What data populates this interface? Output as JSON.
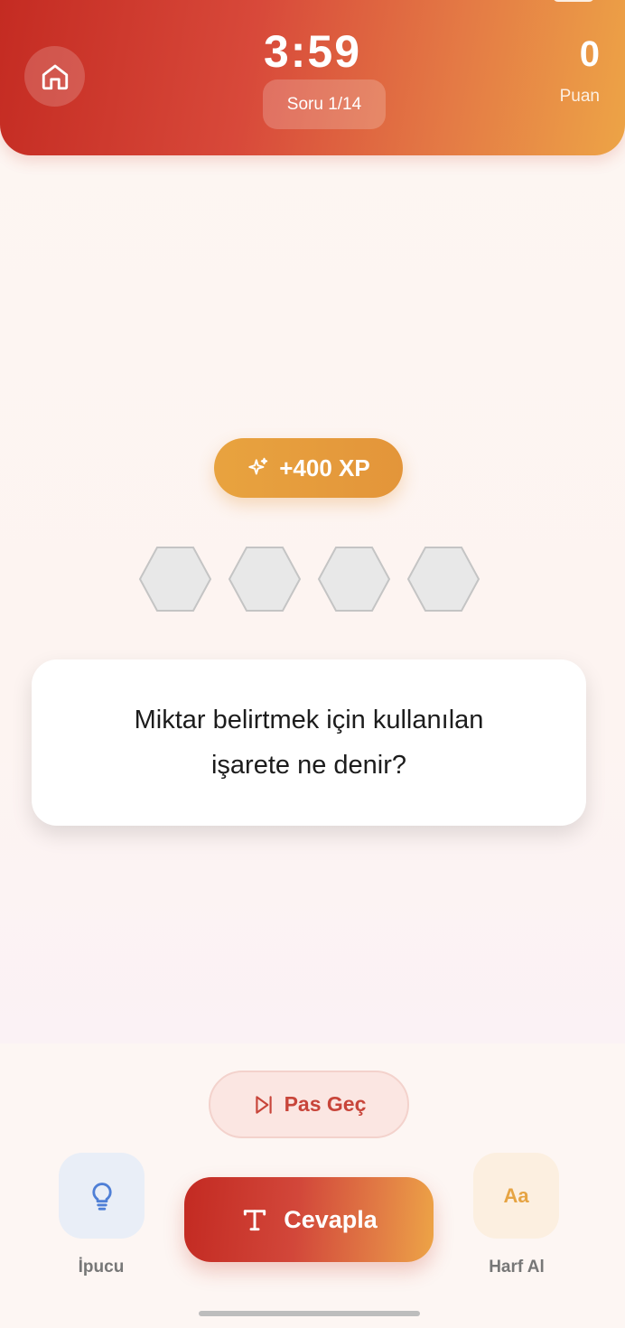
{
  "header": {
    "timer": "3:59",
    "question_counter": "Soru 1/14",
    "score_value": "0",
    "score_label": "Puan",
    "home_icon": "home-icon"
  },
  "reward": {
    "xp_label": "+400 XP",
    "icon": "sparkle-icon"
  },
  "answer_slots": 4,
  "question": {
    "text": "Miktar belirtmek için kullanılan işarete ne denir?"
  },
  "actions": {
    "skip_label": "Pas Geç",
    "skip_icon": "skip-forward-icon",
    "hint_label": "İpucu",
    "hint_icon": "lightbulb-icon",
    "answer_label": "Cevapla",
    "answer_icon": "text-type-icon",
    "letter_label": "Harf Al",
    "letter_icon_text": "Aa"
  },
  "colors": {
    "accent_red": "#c42b22",
    "accent_orange": "#eda446",
    "xp_gold": "#e8a33f",
    "hint_blue": "#4f7fd6"
  }
}
